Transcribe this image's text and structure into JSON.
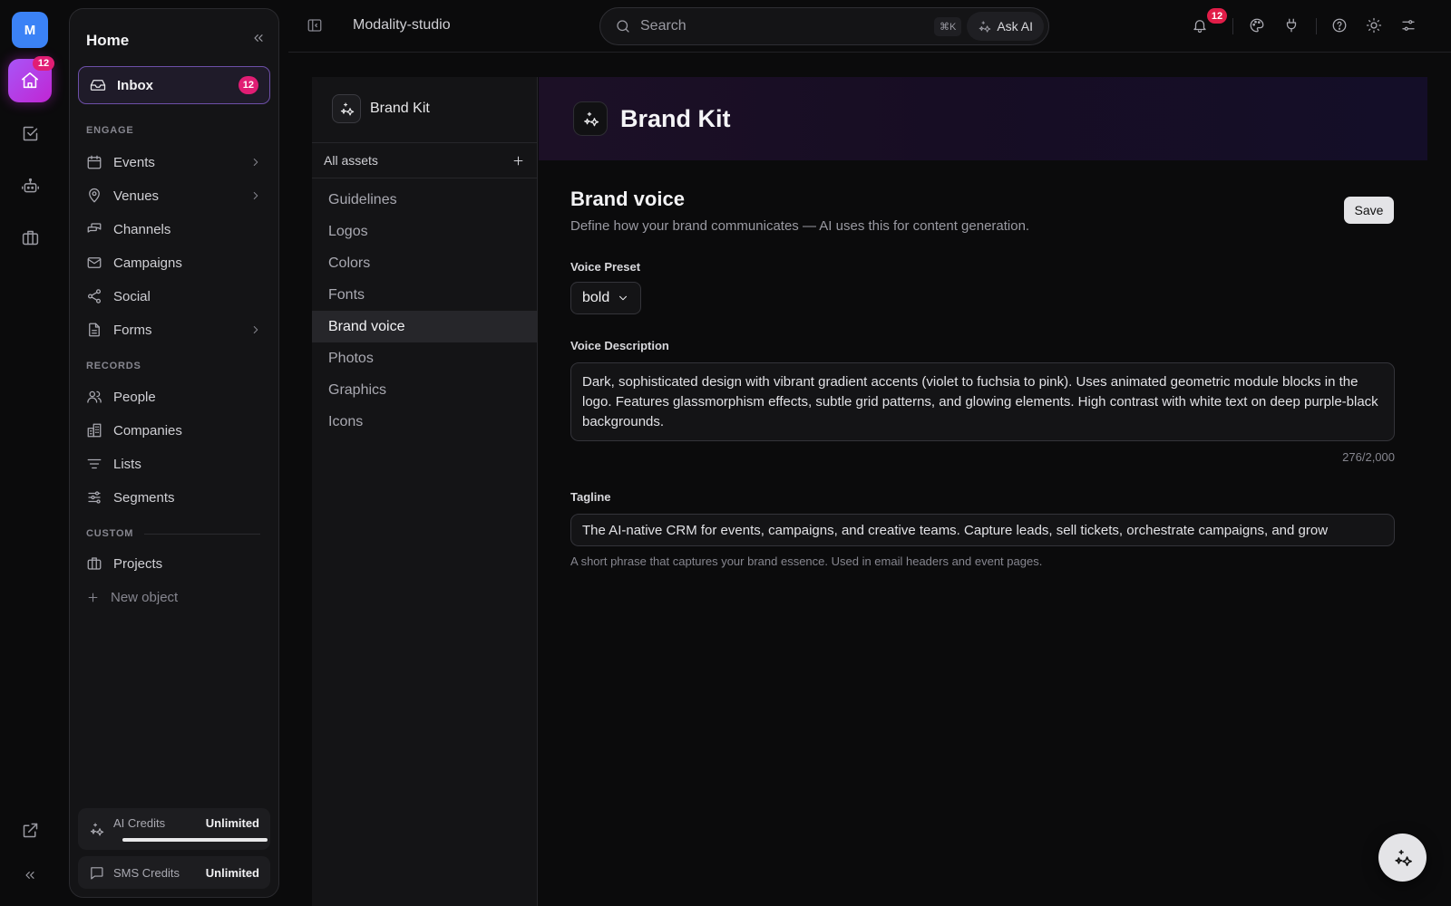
{
  "rail": {
    "avatar_letter": "M",
    "home_badge": "12",
    "icons": [
      "home-icon",
      "tasks-icon",
      "bot-icon",
      "briefcase-icon",
      "external-link-icon",
      "collapse-icon"
    ]
  },
  "sidebar": {
    "title": "Home",
    "inbox": {
      "label": "Inbox",
      "badge": "12"
    },
    "sections": {
      "engage": "ENGAGE",
      "records": "RECORDS",
      "custom": "CUSTOM"
    },
    "engage_items": [
      {
        "label": "Events",
        "icon": "calendar-icon",
        "has_children": true
      },
      {
        "label": "Venues",
        "icon": "map-pin-icon",
        "has_children": true
      },
      {
        "label": "Channels",
        "icon": "chat-icon",
        "has_children": false
      },
      {
        "label": "Campaigns",
        "icon": "mail-icon",
        "has_children": false
      },
      {
        "label": "Social",
        "icon": "share-icon",
        "has_children": false
      },
      {
        "label": "Forms",
        "icon": "document-icon",
        "has_children": true
      }
    ],
    "records_items": [
      {
        "label": "People",
        "icon": "users-icon"
      },
      {
        "label": "Companies",
        "icon": "building-icon"
      },
      {
        "label": "Lists",
        "icon": "list-icon"
      },
      {
        "label": "Segments",
        "icon": "sliders-icon"
      }
    ],
    "custom_items": [
      {
        "label": "Projects",
        "icon": "briefcase-icon"
      }
    ],
    "new_object": "New object",
    "credits": [
      {
        "label": "AI Credits",
        "value": "Unlimited",
        "usage_fraction": 1.0
      },
      {
        "label": "SMS Credits",
        "value": "Unlimited"
      }
    ]
  },
  "topbar": {
    "workspace": "Modality-studio",
    "search_placeholder": "Search",
    "shortcut": "⌘K",
    "ask_ai": "Ask AI",
    "notification_count": "12"
  },
  "assets": {
    "title": "Brand Kit",
    "subheader": "All assets",
    "items": [
      "Guidelines",
      "Logos",
      "Colors",
      "Fonts",
      "Brand voice",
      "Photos",
      "Graphics",
      "Icons"
    ],
    "active_item": "Brand voice"
  },
  "main": {
    "banner_title": "Brand Kit",
    "section_title": "Brand voice",
    "section_desc": "Define how your brand communicates — AI uses this for content generation.",
    "save_label": "Save",
    "voice_preset": {
      "label": "Voice Preset",
      "value": "bold"
    },
    "voice_description": {
      "label": "Voice Description",
      "value": "Dark, sophisticated design with vibrant gradient accents (violet to fuchsia to pink). Uses animated geometric module blocks in the logo. Features glassmorphism effects, subtle grid patterns, and glowing elements. High contrast with white text on deep purple-black backgrounds.",
      "counter": "276/2,000"
    },
    "tagline": {
      "label": "Tagline",
      "value": "The AI-native CRM for events, campaigns, and creative teams. Capture leads, sell tickets, orchestrate campaigns, and grow",
      "helper": "A short phrase that captures your brand essence. Used in email headers and event pages."
    }
  },
  "colors": {
    "accent": "#a855f7",
    "badge": "#e11d74",
    "background": "#0b0b0c",
    "panel": "#141416"
  }
}
